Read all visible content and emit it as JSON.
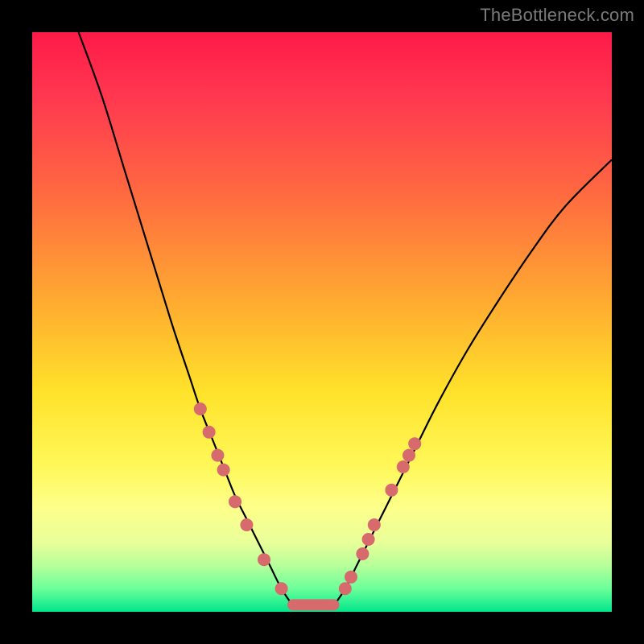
{
  "watermark": "TheBottleneck.com",
  "colors": {
    "dot": "#d66a6c",
    "curve": "#000000",
    "gradient_top": "#ff1a48",
    "gradient_bottom": "#00e68b"
  },
  "chart_data": {
    "type": "line",
    "title": "",
    "xlabel": "",
    "ylabel": "",
    "xlim": [
      0,
      100
    ],
    "ylim": [
      0,
      100
    ],
    "grid": false,
    "legend": false,
    "series": [
      {
        "name": "bottleneck-curve-left",
        "x": [
          8,
          12,
          16,
          20,
          24,
          27,
          29,
          31,
          33,
          35,
          37,
          39,
          41,
          43,
          45
        ],
        "values": [
          100,
          89,
          76,
          63,
          50,
          41,
          35,
          30,
          25,
          20,
          16,
          12,
          8,
          4,
          1
        ]
      },
      {
        "name": "bottleneck-curve-right",
        "x": [
          52,
          54,
          56,
          58,
          60,
          63,
          66,
          70,
          75,
          80,
          86,
          92,
          100
        ],
        "values": [
          1,
          4,
          8,
          12,
          16,
          22,
          28,
          36,
          45,
          53,
          62,
          70,
          78
        ]
      },
      {
        "name": "optimal-flat",
        "x": [
          45,
          52
        ],
        "values": [
          1,
          1
        ]
      }
    ],
    "annotations": {
      "left_dots": [
        {
          "x": 29,
          "y": 35
        },
        {
          "x": 30.5,
          "y": 31
        },
        {
          "x": 32,
          "y": 27
        },
        {
          "x": 33,
          "y": 24.5
        },
        {
          "x": 35,
          "y": 19
        },
        {
          "x": 37,
          "y": 15
        },
        {
          "x": 40,
          "y": 9
        },
        {
          "x": 43,
          "y": 4
        }
      ],
      "right_dots": [
        {
          "x": 54,
          "y": 4
        },
        {
          "x": 55,
          "y": 6
        },
        {
          "x": 57,
          "y": 10
        },
        {
          "x": 58,
          "y": 12.5
        },
        {
          "x": 59,
          "y": 15
        },
        {
          "x": 62,
          "y": 21
        },
        {
          "x": 64,
          "y": 25
        },
        {
          "x": 65,
          "y": 27
        },
        {
          "x": 66,
          "y": 29
        }
      ],
      "flat_segment": {
        "x0": 45,
        "x1": 52,
        "y": 1.2
      }
    }
  }
}
